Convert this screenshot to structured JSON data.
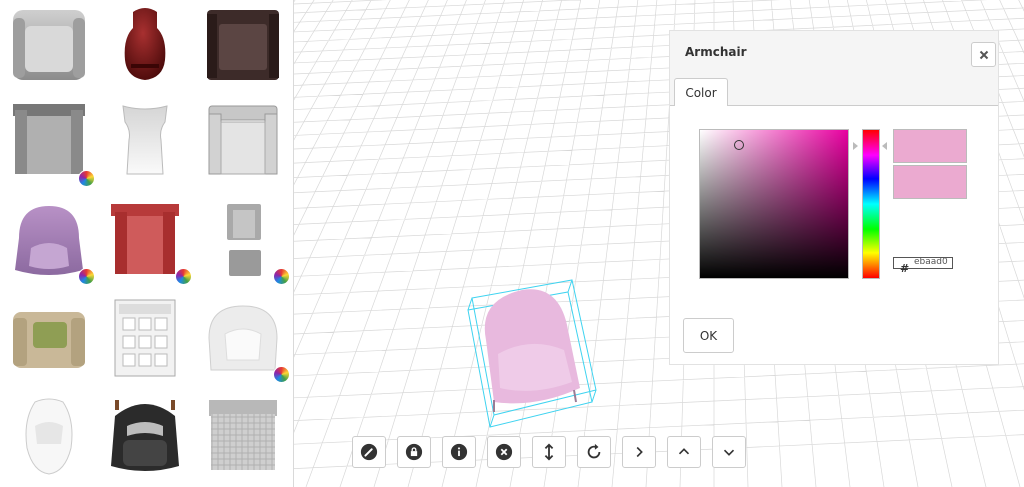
{
  "catalog": {
    "items": [
      {
        "name": "armchair-gray",
        "has_color_options": false
      },
      {
        "name": "chair-red-leather",
        "has_color_options": false
      },
      {
        "name": "armchair-dark-brown",
        "has_color_options": false
      },
      {
        "name": "armchair-gray-square",
        "has_color_options": true
      },
      {
        "name": "chair-white-curved",
        "has_color_options": false
      },
      {
        "name": "armchair-silver",
        "has_color_options": false
      },
      {
        "name": "armchair-tub-mauve",
        "has_color_options": true
      },
      {
        "name": "armchair-red",
        "has_color_options": true
      },
      {
        "name": "chair-with-ottoman",
        "has_color_options": true
      },
      {
        "name": "armchair-beige-green-cushion",
        "has_color_options": false
      },
      {
        "name": "armchair-white-tufted",
        "has_color_options": false
      },
      {
        "name": "armchair-white-rounded",
        "has_color_options": true
      },
      {
        "name": "chair-egg-white",
        "has_color_options": false
      },
      {
        "name": "chair-black-frame",
        "has_color_options": false
      },
      {
        "name": "chair-gray-woven",
        "has_color_options": false
      }
    ]
  },
  "toolbar": {
    "buttons": [
      {
        "icon": "paintbrush-icon"
      },
      {
        "icon": "lock-icon"
      },
      {
        "icon": "info-icon"
      },
      {
        "icon": "delete-icon"
      },
      {
        "icon": "resize-vertical-icon"
      },
      {
        "icon": "rotate-icon"
      },
      {
        "icon": "chevron-right-icon"
      },
      {
        "icon": "chevron-up-icon"
      },
      {
        "icon": "chevron-down-icon"
      }
    ]
  },
  "dialog": {
    "title": "Armchair",
    "tabs": [
      {
        "label": "Color",
        "active": true
      }
    ],
    "color_picker": {
      "hex_symbol": "#",
      "hex_value": "ebaad0",
      "swatch_new": "#ebaad0",
      "swatch_current": "#ebaad0",
      "hue_color": "#e800a0"
    },
    "ok_label": "OK"
  },
  "colors": {
    "selected_chair": "#e8b9de",
    "selection_box": "#3fd3f0",
    "grid_line": "#d8d8d8"
  }
}
